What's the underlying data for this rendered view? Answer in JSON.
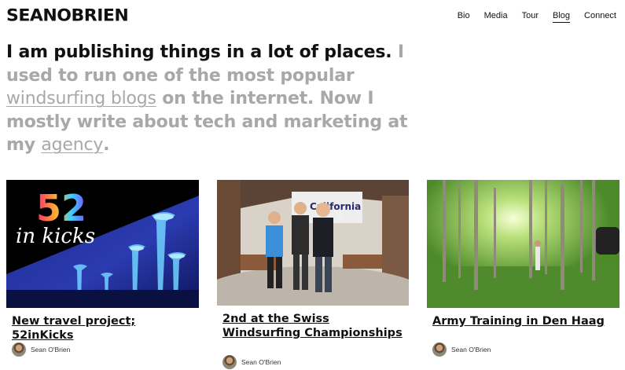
{
  "logo": {
    "text": "SEANOBRIEN"
  },
  "nav": [
    {
      "label": "Bio"
    },
    {
      "label": "Media"
    },
    {
      "label": "Tour"
    },
    {
      "label": "Blog"
    },
    {
      "label": "Connect"
    }
  ],
  "intro": {
    "dark": "I am publishing things in a lot of places.",
    "light_1": " I used to run one of the most popular ",
    "link_1": "windsurfing blogs",
    "light_2": " on the internet. Now I mostly write about tech and marketing at my ",
    "link_2": "agency",
    "light_3": "."
  },
  "cards": [
    {
      "title": "New travel project; 52inKicks",
      "author": "Sean O'Brien",
      "image_text_1": "52",
      "image_text_2": "in kicks"
    },
    {
      "title": "2nd at the Swiss Windsurfing Championships",
      "author": "Sean O'Brien",
      "banner": "California"
    },
    {
      "title": "Army Training in Den Haag",
      "author": "Sean O'Brien"
    }
  ]
}
